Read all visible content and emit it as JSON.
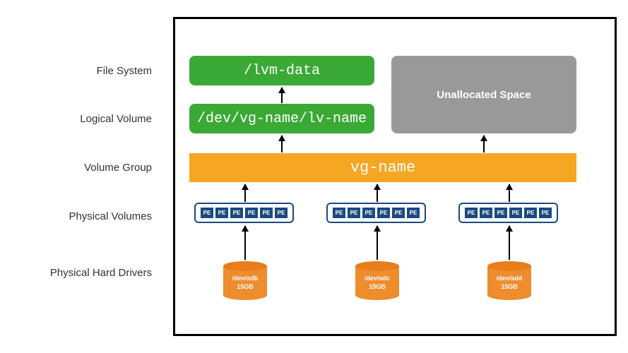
{
  "labels": {
    "fs": "File System",
    "lv": "Logical Volume",
    "vg": "Volume Group",
    "pv": "Physical Volumes",
    "phd": "Physical Hard Drivers"
  },
  "boxes": {
    "filesystem": "/lvm-data",
    "logical_volume": "/dev/vg-name/lv-name",
    "unallocated": "Unallocated Space",
    "volume_group": "vg-name"
  },
  "pe_label": "PE",
  "disks": [
    {
      "dev": "/dev/sdb",
      "size": "15GB"
    },
    {
      "dev": "/dev/sdc",
      "size": "15GB"
    },
    {
      "dev": "/dev/sdd",
      "size": "15GB"
    }
  ]
}
